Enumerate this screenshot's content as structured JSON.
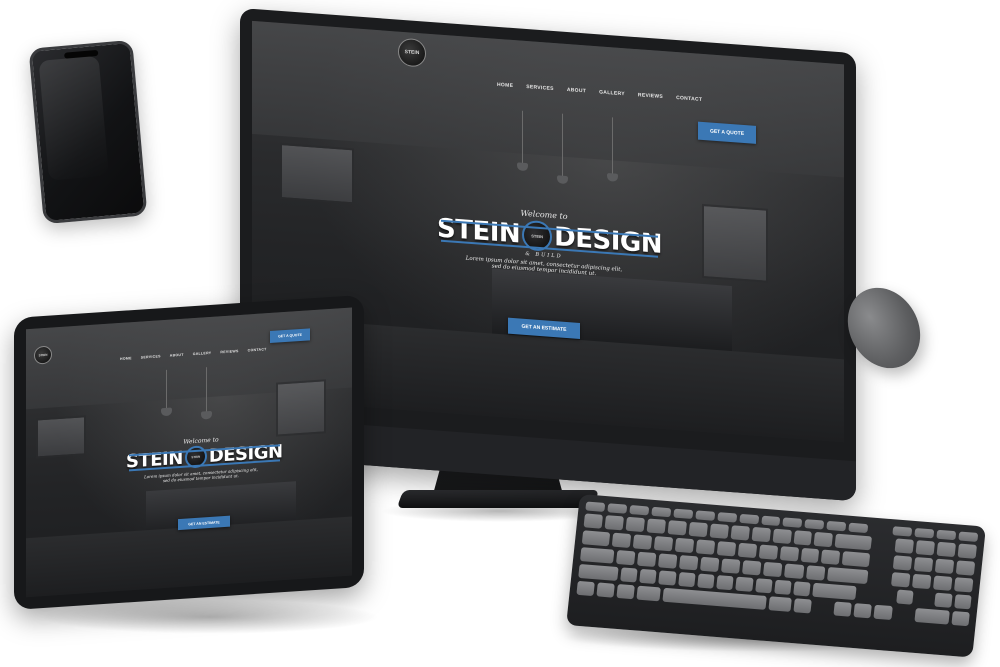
{
  "monitor_site": {
    "logo_text": "STEIN",
    "nav": [
      "HOME",
      "SERVICES",
      "ABOUT",
      "GALLERY",
      "REVIEWS",
      "CONTACT"
    ],
    "header_cta": "GET A QUOTE",
    "hero": {
      "welcome": "Welcome to",
      "brand_left": "STEIN",
      "brand_right": "DESIGN",
      "brand_sub": "& BUILD",
      "tagline_1": "Lorem ipsum dolor sit amet, consectetur adipiscing elit,",
      "tagline_2": "sed do eiusmod tempor incididunt ut.",
      "cta": "GET AN ESTIMATE"
    }
  },
  "tablet_site": {
    "logo_text": "STEIN",
    "nav": [
      "HOME",
      "SERVICES",
      "ABOUT",
      "GALLERY",
      "REVIEWS",
      "CONTACT"
    ],
    "header_cta": "GET A QUOTE",
    "hero": {
      "welcome": "Welcome to",
      "brand_left": "STEIN",
      "brand_right": "DESIGN",
      "tagline_1": "Lorem ipsum dolor sit amet, consectetur adipiscing elit,",
      "tagline_2": "sed do eiusmod tempor incididunt ut.",
      "cta": "GET AN ESTIMATE"
    }
  },
  "colors": {
    "accent_blue": "#3b78b5",
    "device_dark": "#1b1c1e",
    "key_gray": "#7d7e81"
  }
}
